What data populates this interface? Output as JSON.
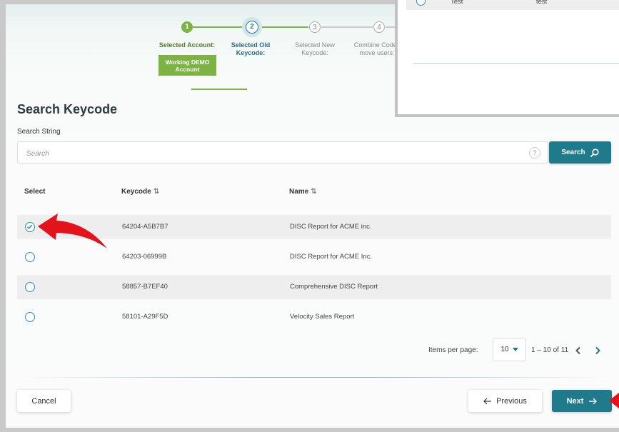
{
  "stepper": {
    "steps": [
      {
        "number": "1",
        "label": "Selected Account:",
        "status": "done"
      },
      {
        "number": "2",
        "label": "Selected Old Keycode:",
        "status": "active"
      },
      {
        "number": "3",
        "label": "Selected New Keycode:",
        "status": "pending"
      },
      {
        "number": "4",
        "label": "Combine Codes move users:",
        "status": "pending"
      }
    ],
    "account_badge_line1": "Working DEMO",
    "account_badge_line2": "Account"
  },
  "page": {
    "title": "Search Keycode",
    "search_label": "Search String",
    "search_placeholder": "Search",
    "help_glyph": "?",
    "search_button": "Search"
  },
  "table": {
    "headers": {
      "select": "Select",
      "keycode": "Keycode",
      "name": "Name"
    },
    "sort_glyph": "⇅",
    "rows": [
      {
        "keycode": "64204-A5B7B7",
        "name": "DISC Report for ACME inc.",
        "selected": true
      },
      {
        "keycode": "64203-06999B",
        "name": "DISC Report for ACME Inc.",
        "selected": false
      },
      {
        "keycode": "58857-B7EF40",
        "name": "Comprehensive DISC Report",
        "selected": false
      },
      {
        "keycode": "58101-A29F5D",
        "name": "Velocity Sales Report",
        "selected": false
      }
    ]
  },
  "pager": {
    "items_per_page_label": "Items per page:",
    "items_per_page_value": "10",
    "range": "1 – 10 of 11"
  },
  "footer": {
    "cancel": "Cancel",
    "previous": "Previous",
    "next": "Next"
  },
  "popup": {
    "row": {
      "col1": "Test",
      "col2": "test"
    }
  },
  "colors": {
    "accent": "#1f7a8c",
    "success": "#7cb342",
    "annotation_arrow": "#e3121b"
  }
}
